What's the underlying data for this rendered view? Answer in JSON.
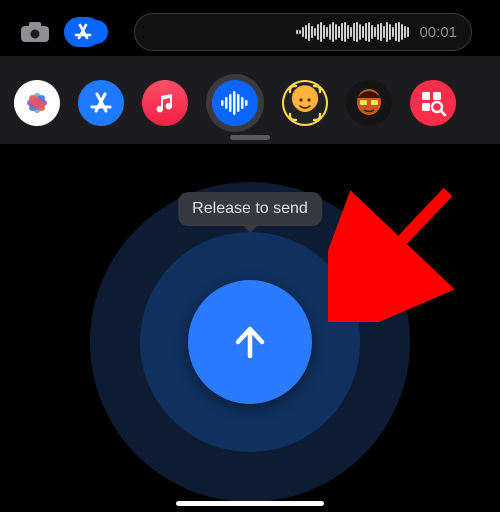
{
  "recording": {
    "duration_text": "00:01"
  },
  "tooltip": {
    "text": "Release to send"
  },
  "drawer": {
    "selected_index": 3,
    "items": [
      {
        "name": "photos"
      },
      {
        "name": "app-store"
      },
      {
        "name": "music"
      },
      {
        "name": "audio-message"
      },
      {
        "name": "memoji-scan"
      },
      {
        "name": "memoji"
      },
      {
        "name": "hashtag-images"
      }
    ]
  },
  "colors": {
    "accent_blue": "#2a7bff",
    "halo_outer": "#0e1c33",
    "halo_inner": "#10305e",
    "drawer_bg": "#1c1c1e",
    "annotation_red": "#ff0000"
  }
}
